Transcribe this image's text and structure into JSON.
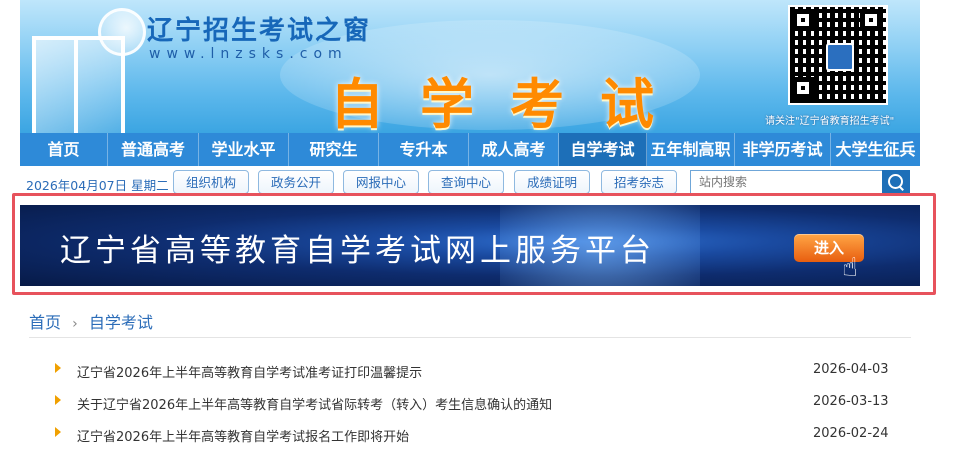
{
  "header": {
    "site_title": "辽宁招生考试之窗",
    "site_url": "www.lnzsks.com",
    "section_title": "自学考试",
    "qr_caption": "请关注\"辽宁省教育招生考试\""
  },
  "nav": {
    "items": [
      {
        "label": "首页"
      },
      {
        "label": "普通高考"
      },
      {
        "label": "学业水平"
      },
      {
        "label": "研究生"
      },
      {
        "label": "专升本"
      },
      {
        "label": "成人高考"
      },
      {
        "label": "自学考试",
        "active": true
      },
      {
        "label": "五年制高职"
      },
      {
        "label": "非学历考试"
      },
      {
        "label": "大学生征兵"
      }
    ]
  },
  "subbar": {
    "date": "2026年04月07日 星期二",
    "links": [
      {
        "label": "组织机构"
      },
      {
        "label": "政务公开"
      },
      {
        "label": "网报中心"
      },
      {
        "label": "查询中心"
      },
      {
        "label": "成绩证明"
      },
      {
        "label": "招考杂志"
      }
    ],
    "search_placeholder": "站内搜索"
  },
  "banner": {
    "title": "辽宁省高等教育自学考试网上服务平台",
    "button": "进入"
  },
  "breadcrumb": {
    "home": "首页",
    "sep": "›",
    "current": "自学考试"
  },
  "news": [
    {
      "title": "辽宁省2026年上半年高等教育自学考试准考证打印温馨提示",
      "date": "2026-04-03"
    },
    {
      "title": "关于辽宁省2026年上半年高等教育自学考试省际转考（转入）考生信息确认的通知",
      "date": "2026-03-13"
    },
    {
      "title": "辽宁省2026年上半年高等教育自学考试报名工作即将开始",
      "date": "2026-02-24"
    }
  ],
  "colors": {
    "nav_bg": "#2e8ad8",
    "nav_active": "#1d6fb8",
    "accent_orange": "#ff8a00",
    "highlight_frame": "#e7525c"
  }
}
